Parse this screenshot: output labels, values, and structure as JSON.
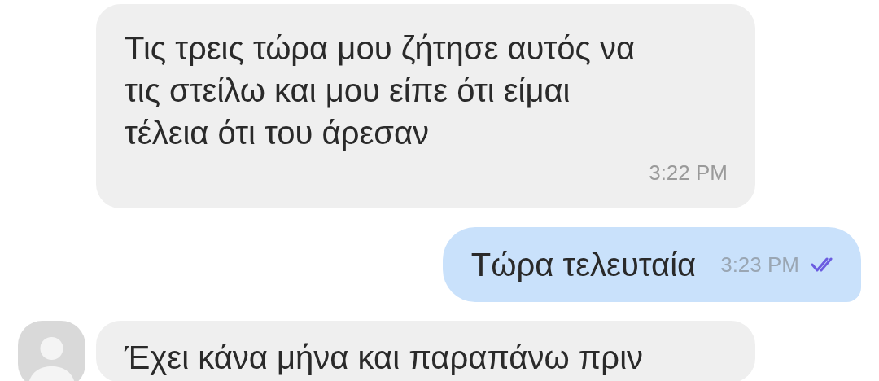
{
  "messages": [
    {
      "kind": "incoming",
      "show_avatar": false,
      "text": "Τις τρεις τώρα μου ζήτησε αυτός να τις στείλω και μου είπε ότι είμαι τέλεια ότι του άρεσαν",
      "time": "3:22 PM"
    },
    {
      "kind": "outgoing",
      "text": "Τώρα τελευταία",
      "time": "3:23 PM",
      "read": true
    },
    {
      "kind": "incoming",
      "show_avatar": true,
      "text": "Έχει κάνα μήνα και παραπάνω πριν"
    }
  ]
}
